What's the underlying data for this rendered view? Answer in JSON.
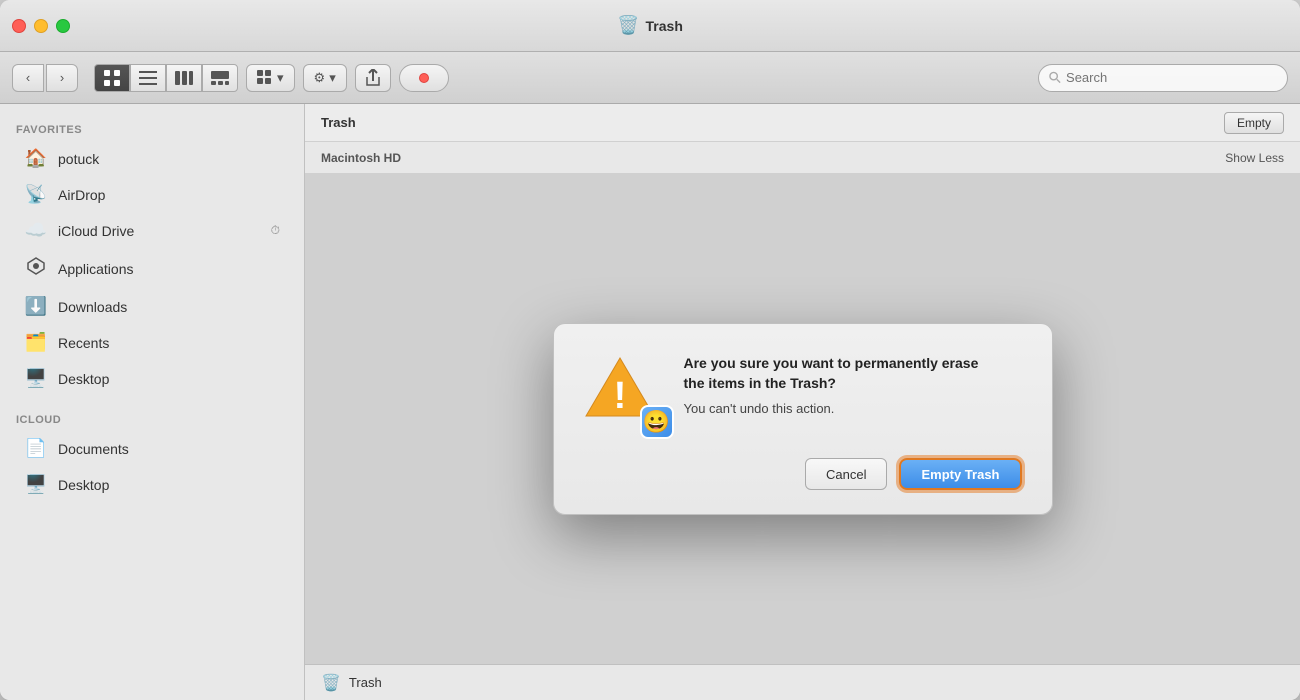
{
  "window": {
    "title": "Trash",
    "title_icon": "🗑️"
  },
  "titlebar": {
    "traffic_lights": [
      "close",
      "minimize",
      "maximize"
    ]
  },
  "toolbar": {
    "back_label": "‹",
    "forward_label": "›",
    "view_icon_label": "⊞",
    "search_placeholder": "Search",
    "arrange_label": "⊞ ▾",
    "action_label": "⚙ ▾",
    "share_label": "↑"
  },
  "path_bar": {
    "title": "Trash",
    "empty_button_label": "Empty"
  },
  "section_header": {
    "title": "Macintosh HD",
    "show_less_label": "Show Less"
  },
  "sidebar": {
    "favorites_label": "Favorites",
    "items": [
      {
        "id": "potuck",
        "icon": "🏠",
        "label": "potuck"
      },
      {
        "id": "airdrop",
        "icon": "📡",
        "label": "AirDrop"
      },
      {
        "id": "icloud-drive",
        "icon": "☁️",
        "label": "iCloud Drive",
        "badge": "⏱"
      },
      {
        "id": "applications",
        "icon": "🚀",
        "label": "Applications"
      },
      {
        "id": "downloads",
        "icon": "⬇️",
        "label": "Downloads"
      },
      {
        "id": "recents",
        "icon": "🗂️",
        "label": "Recents"
      },
      {
        "id": "desktop",
        "icon": "🖥️",
        "label": "Desktop"
      }
    ],
    "icloud_label": "iCloud",
    "icloud_items": [
      {
        "id": "documents",
        "icon": "📄",
        "label": "Documents"
      },
      {
        "id": "desktop-icloud",
        "icon": "🖥️",
        "label": "Desktop"
      }
    ]
  },
  "bottom_bar": {
    "icon": "🗑️",
    "label": "Trash"
  },
  "modal": {
    "title": "Are you sure you want to permanently erase\nthe items in the Trash?",
    "subtitle": "You can't undo this action.",
    "cancel_label": "Cancel",
    "confirm_label": "Empty Trash"
  }
}
